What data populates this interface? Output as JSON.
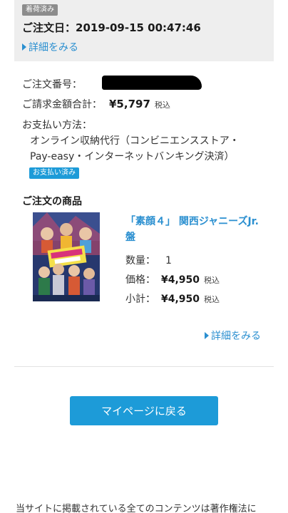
{
  "header": {
    "status_badge": "着荷済み",
    "order_date_label": "ご注文日：",
    "order_date_value": "2019-09-15 00:47:46",
    "detail_link": "詳細をみる"
  },
  "order": {
    "number_label": "ご注文番号：",
    "total_label": "ご請求金額合計：",
    "total_value": "¥5,797",
    "tax_label": "税込",
    "payment_label": "お支払い方法：",
    "payment_line1": "オンライン収納代行（コンビニエンスストア・",
    "payment_line2": "Pay-easy・インターネットバンキング決済）",
    "payment_badge": "お支払い済み"
  },
  "products": {
    "section_title": "ご注文の商品",
    "items": [
      {
        "name": "「素顔４」 関西ジャニーズJr.盤",
        "quantity_label": "数量：",
        "quantity_value": "1",
        "price_label": "価格：",
        "price_value": "¥4,950",
        "subtotal_label": "小計：",
        "subtotal_value": "¥4,950",
        "tax_label": "税込"
      }
    ],
    "detail_link": "詳細をみる"
  },
  "actions": {
    "mypage_button": "マイページに戻る"
  },
  "footer": {
    "text": "当サイトに掲載されている全てのコンテンツは著作権法に"
  },
  "colors": {
    "accent": "#1d9bd8",
    "link": "#2a8fd0",
    "header_bg": "#eeeeee",
    "badge_gray": "#8c8c8c"
  }
}
